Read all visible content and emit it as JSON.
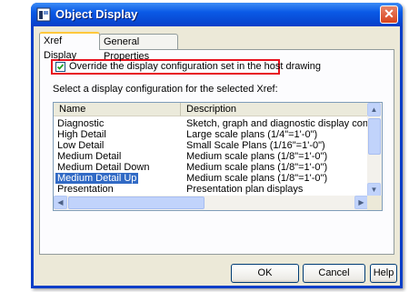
{
  "window": {
    "title": "Object Display",
    "close_glyph": "✕",
    "title_color": "#0a3ec8"
  },
  "tabs": [
    {
      "label": "Xref Display",
      "active": true
    },
    {
      "label": "General Properties",
      "active": false
    }
  ],
  "override": {
    "checked": true,
    "label": "Override the display configuration set in the host drawing"
  },
  "select_label": "Select a display configuration for the selected Xref:",
  "list": {
    "columns": [
      "Name",
      "Description"
    ],
    "rows": [
      {
        "name": "Diagnostic",
        "desc": "Sketch, graph and diagnostic display configura"
      },
      {
        "name": "High Detail",
        "desc": "Large scale plans (1/4\"=1'-0\")"
      },
      {
        "name": "Low Detail",
        "desc": "Small Scale Plans (1/16\"=1'-0\")"
      },
      {
        "name": "Medium Detail",
        "desc": "Medium scale plans (1/8\"=1'-0\")"
      },
      {
        "name": "Medium Detail Down",
        "desc": "Medium scale plans (1/8\"=1'-0\")"
      },
      {
        "name": "Medium Detail Up",
        "desc": "Medium scale plans (1/8\"=1'-0\")",
        "selected": true
      },
      {
        "name": "Presentation",
        "desc": "Presentation plan displays"
      }
    ],
    "selection_color": "#316ac5"
  },
  "buttons": {
    "ok": "OK",
    "cancel": "Cancel",
    "help": "Help"
  }
}
